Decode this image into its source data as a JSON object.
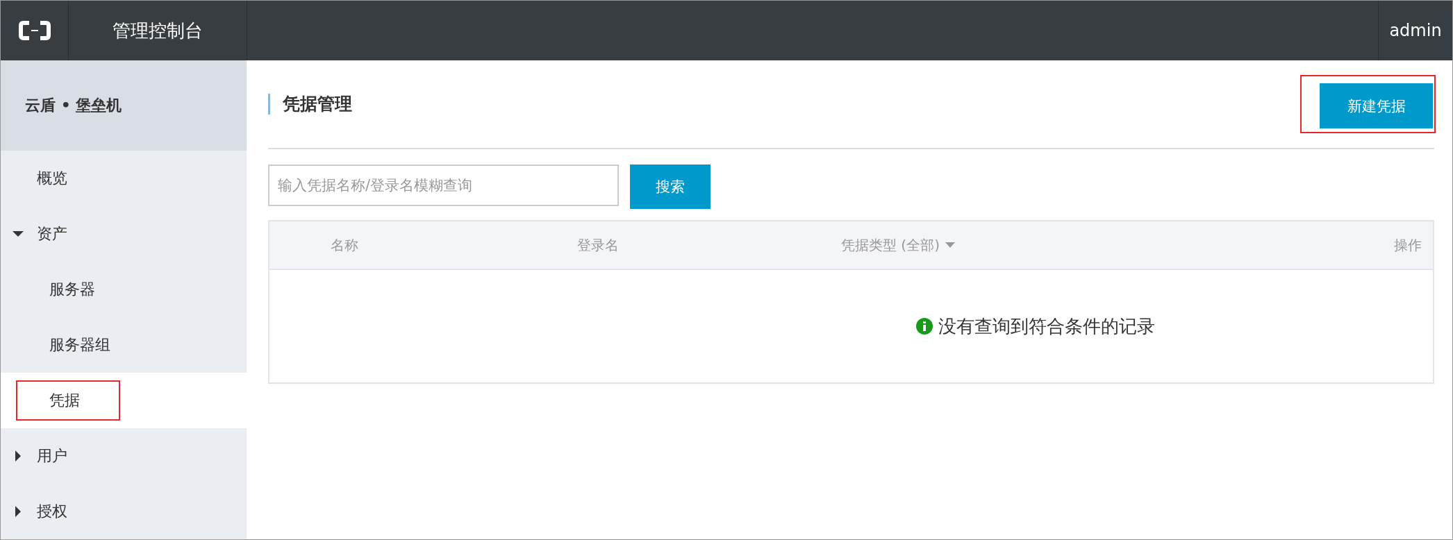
{
  "topbar": {
    "title": "管理控制台",
    "user": "admin"
  },
  "sidebar": {
    "product": "云盾 • 堡垒机",
    "items": [
      {
        "label": "概览",
        "kind": "link",
        "selected": false,
        "highlighted": false
      },
      {
        "label": "资产",
        "kind": "group",
        "expanded": true,
        "selected": false,
        "highlighted": false,
        "children": [
          {
            "label": "服务器",
            "selected": false,
            "highlighted": false
          },
          {
            "label": "服务器组",
            "selected": false,
            "highlighted": false
          },
          {
            "label": "凭据",
            "selected": true,
            "highlighted": true
          }
        ]
      },
      {
        "label": "用户",
        "kind": "group",
        "expanded": false,
        "selected": false,
        "highlighted": false
      },
      {
        "label": "授权",
        "kind": "group",
        "expanded": false,
        "selected": false,
        "highlighted": false
      }
    ]
  },
  "page": {
    "title": "凭据管理",
    "new_button": {
      "label": "新建凭据",
      "highlighted": true
    },
    "search": {
      "placeholder": "输入凭据名称/登录名模糊查询",
      "button": "搜索"
    },
    "table": {
      "columns": [
        {
          "label": "名称",
          "sortable": false
        },
        {
          "label": "登录名",
          "sortable": false
        },
        {
          "label": "凭据类型 (全部)",
          "sortable": true
        },
        {
          "label": "操作",
          "sortable": false
        }
      ],
      "empty_message": "没有查询到符合条件的记录"
    }
  }
}
